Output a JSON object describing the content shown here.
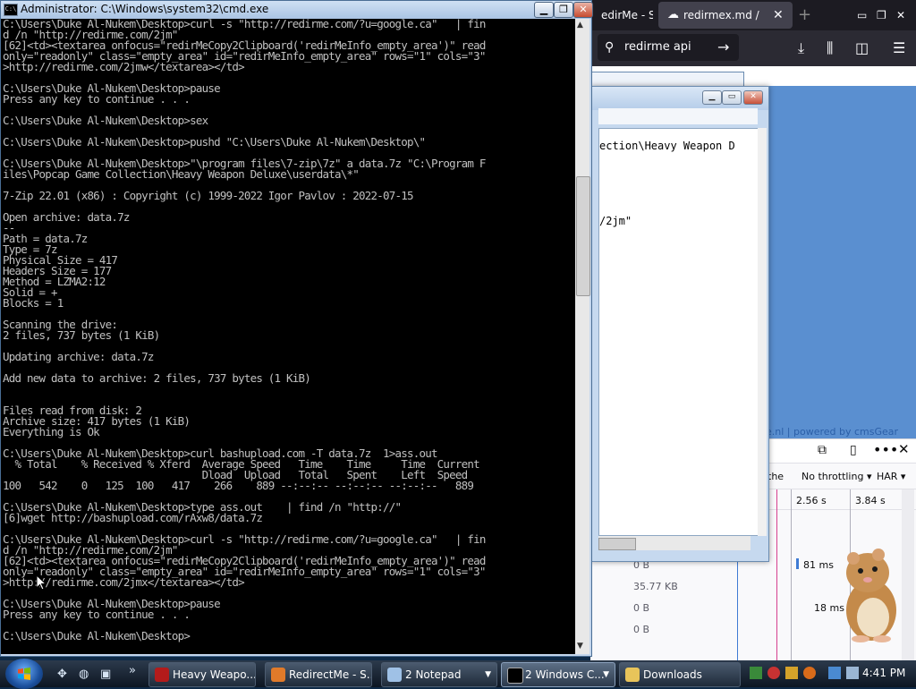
{
  "cmd": {
    "title": "Administrator: C:\\Windows\\system32\\cmd.exe",
    "lines": [
      "C:\\Users\\Duke Al-Nukem\\Desktop>curl -s \"http://redirme.com/?u=google.ca\"   | fin",
      "d /n \"http://redirme.com/2jm\"",
      "[62]<td><textarea onfocus=\"redirMeCopy2Clipboard('redirMeInfo_empty_area')\" read",
      "only=\"readonly\" class=\"empty_area\" id=\"redirMeInfo_empty_area\" rows=\"1\" cols=\"3\"",
      ">http://redirme.com/2jmw</textarea></td>",
      "",
      "C:\\Users\\Duke Al-Nukem\\Desktop>pause",
      "Press any key to continue . . .",
      "",
      "C:\\Users\\Duke Al-Nukem\\Desktop>sex",
      "",
      "C:\\Users\\Duke Al-Nukem\\Desktop>pushd \"C:\\Users\\Duke Al-Nukem\\Desktop\\\"",
      "",
      "C:\\Users\\Duke Al-Nukem\\Desktop>\"\\program files\\7-zip\\7z\" a data.7z \"C:\\Program F",
      "iles\\Popcap Game Collection\\Heavy Weapon Deluxe\\userdata\\*\"",
      "",
      "7-Zip 22.01 (x86) : Copyright (c) 1999-2022 Igor Pavlov : 2022-07-15",
      "",
      "Open archive: data.7z",
      "--",
      "Path = data.7z",
      "Type = 7z",
      "Physical Size = 417",
      "Headers Size = 177",
      "Method = LZMA2:12",
      "Solid = +",
      "Blocks = 1",
      "",
      "Scanning the drive:",
      "2 files, 737 bytes (1 KiB)",
      "",
      "Updating archive: data.7z",
      "",
      "Add new data to archive: 2 files, 737 bytes (1 KiB)",
      "",
      "",
      "Files read from disk: 2",
      "Archive size: 417 bytes (1 KiB)",
      "Everything is Ok",
      "",
      "C:\\Users\\Duke Al-Nukem\\Desktop>curl bashupload.com -T data.7z  1>ass.out",
      "  % Total    % Received % Xferd  Average Speed   Time    Time     Time  Current",
      "                                 Dload  Upload   Total   Spent    Left  Speed",
      "100   542    0   125  100   417    266    889 --:--:-- --:--:-- --:--:--   889",
      "",
      "C:\\Users\\Duke Al-Nukem\\Desktop>type ass.out    | find /n \"http://\"",
      "[6]wget http://bashupload.com/rAxw8/data.7z",
      "",
      "C:\\Users\\Duke Al-Nukem\\Desktop>curl -s \"http://redirme.com/?u=google.ca\"   | fin",
      "d /n \"http://redirme.com/2jm\"",
      "[62]<td><textarea onfocus=\"redirMeCopy2Clipboard('redirMeInfo_empty_area')\" read",
      "only=\"readonly\" class=\"empty_area\" id=\"redirMeInfo_empty_area\" rows=\"1\" cols=\"3\"",
      ">http://redirme.com/2jmx</textarea></td>",
      "",
      "C:\\Users\\Duke Al-Nukem\\Desktop>pause",
      "Press any key to continue . . .",
      "",
      "C:\\Users\\Duke Al-Nukem\\Desktop>"
    ]
  },
  "browser": {
    "tabs": [
      "edirMe - Sh",
      "redirmex.md /"
    ],
    "search_text": "redirme api",
    "footer_link_1": "e.nl",
    "footer_sep": " | ",
    "footer_link_2": "powered by cmsGear",
    "devtools": {
      "cache_col": "the",
      "throttle": "No throttling ▾",
      "har": "HAR ▾",
      "time_ticks": [
        "2.56 s",
        "3.84 s"
      ],
      "rows": [
        {
          "size": "0 B",
          "ms": "81 ms"
        },
        {
          "size": "35.77 KB",
          "ms": ""
        },
        {
          "size": "0 B",
          "ms": "18 ms"
        },
        {
          "size": "0 B",
          "ms": ""
        }
      ]
    }
  },
  "notepad": {
    "lines": [
      "ection\\Heavy Weapon D",
      "",
      "",
      "",
      "",
      "",
      "",
      "/2jm\""
    ]
  },
  "taskbar": {
    "tasks": [
      "Heavy Weapo...",
      "RedirectMe - S...",
      "2 Notepad",
      "2 Windows C...",
      "Downloads"
    ],
    "clock": "4:41 PM"
  },
  "colors": {
    "console_bg": "#000000",
    "console_fg": "#c0c0c0",
    "taskbar": "#1a2636",
    "browser_accent": "#5a8fd0"
  }
}
